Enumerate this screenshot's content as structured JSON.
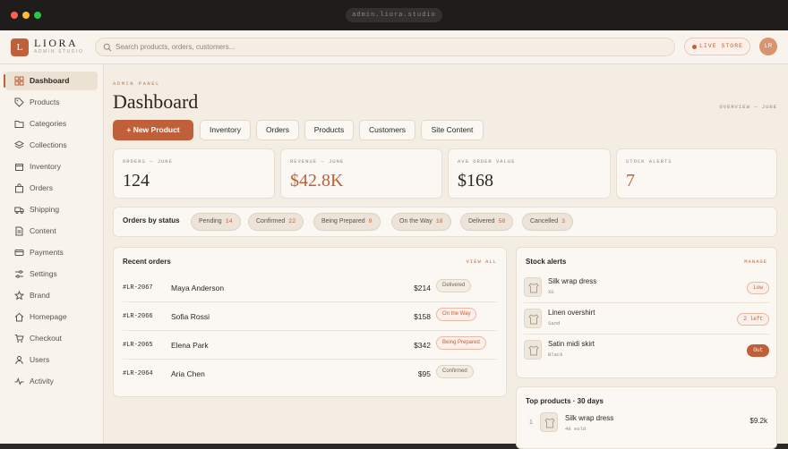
{
  "window": {
    "url": "admin.liora.studio"
  },
  "brand": {
    "mark": "L",
    "name": "LIORA",
    "subtitle": "ADMIN STUDIO",
    "accent": "#c0603a"
  },
  "topbar": {
    "search_placeholder": "Search products, orders, customers...",
    "live_label": "LIVE STORE",
    "avatar_initials": "LR"
  },
  "sidebar": {
    "items": [
      {
        "label": "Dashboard",
        "icon": "grid-icon",
        "active": true
      },
      {
        "label": "Products",
        "icon": "tag-icon"
      },
      {
        "label": "Categories",
        "icon": "folder-icon"
      },
      {
        "label": "Collections",
        "icon": "layers-icon"
      },
      {
        "label": "Inventory",
        "icon": "box-icon"
      },
      {
        "label": "Orders",
        "icon": "bag-icon"
      },
      {
        "label": "Shipping",
        "icon": "truck-icon"
      },
      {
        "label": "Content",
        "icon": "document-icon"
      },
      {
        "label": "Payments",
        "icon": "card-icon"
      },
      {
        "label": "Settings",
        "icon": "sliders-icon"
      },
      {
        "label": "Brand",
        "icon": "star-icon"
      },
      {
        "label": "Homepage",
        "icon": "home-icon"
      },
      {
        "label": "Checkout",
        "icon": "cart-icon"
      },
      {
        "label": "Users",
        "icon": "user-icon"
      },
      {
        "label": "Activity",
        "icon": "pulse-icon"
      }
    ]
  },
  "header": {
    "eyebrow": "ADMIN PANEL",
    "title": "Dashboard",
    "overview": "OVERVIEW — JUNE"
  },
  "actions": {
    "new_product": "New Product",
    "quick_links": [
      "Inventory",
      "Orders",
      "Products",
      "Customers",
      "Site Content"
    ]
  },
  "kpis": [
    {
      "label": "ORDERS — JUNE",
      "value": "124"
    },
    {
      "label": "REVENUE — JUNE",
      "value": "$42.8K"
    },
    {
      "label": "AVG ORDER VALUE",
      "value": "$168"
    },
    {
      "label": "STOCK ALERTS",
      "value": "7"
    }
  ],
  "status": {
    "title": "Orders by status",
    "chips": [
      {
        "label": "Pending",
        "count": "14"
      },
      {
        "label": "Confirmed",
        "count": "22"
      },
      {
        "label": "Being Prepared",
        "count": "9"
      },
      {
        "label": "On the Way",
        "count": "18"
      },
      {
        "label": "Delivered",
        "count": "58"
      },
      {
        "label": "Cancelled",
        "count": "3"
      }
    ]
  },
  "recent_orders": {
    "title": "Recent orders",
    "link": "VIEW ALL",
    "rows": [
      {
        "id": "#LR-2067",
        "name": "Maya Anderson",
        "amount": "$214",
        "status": "Delivered"
      },
      {
        "id": "#LR-2066",
        "name": "Sofia Rossi",
        "amount": "$158",
        "status": "On the Way"
      },
      {
        "id": "#LR-2065",
        "name": "Elena Park",
        "amount": "$342",
        "status": "Being Prepared"
      },
      {
        "id": "#LR-2064",
        "name": "Aria Chen",
        "amount": "$95",
        "status": "Confirmed"
      }
    ]
  },
  "stock_alerts": {
    "title": "Stock alerts",
    "link": "MANAGE",
    "rows": [
      {
        "name": "Silk wrap dress",
        "sub": "XS",
        "badge": "Low"
      },
      {
        "name": "Linen overshirt",
        "sub": "Sand",
        "badge": "2 left"
      },
      {
        "name": "Satin midi skirt",
        "sub": "Black",
        "badge": "Out"
      }
    ]
  },
  "top_products": {
    "title": "Top products · 30 days",
    "rows": [
      {
        "rank": "1",
        "name": "Silk wrap dress",
        "sub": "48 sold",
        "amount": "$9.2k"
      }
    ]
  }
}
